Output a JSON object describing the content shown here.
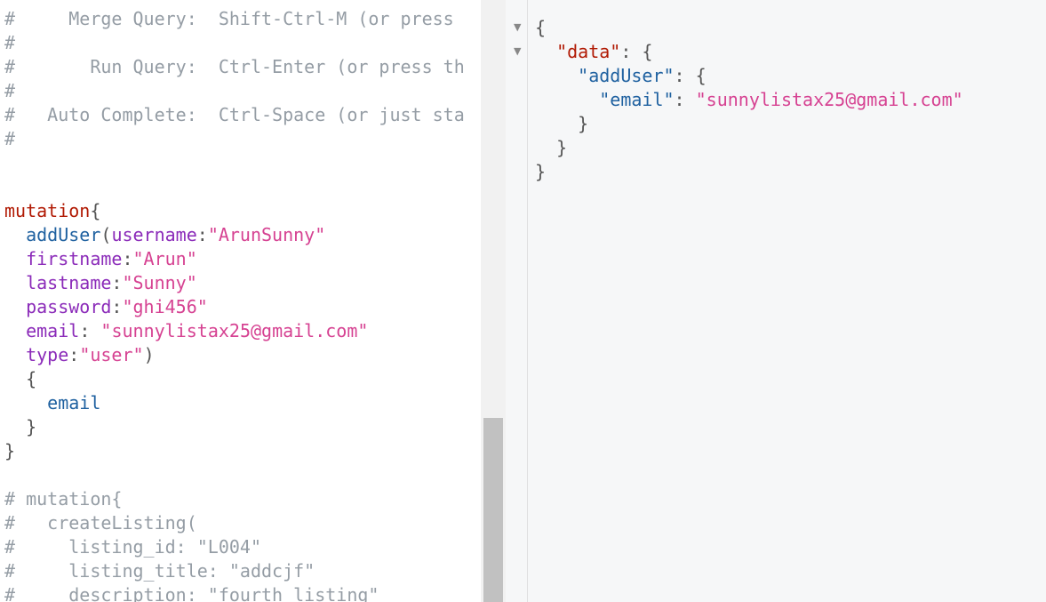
{
  "editor": {
    "lines": [
      [
        [
          "comment",
          "#     Merge Query:  Shift-Ctrl-M (or press"
        ]
      ],
      [
        [
          "comment",
          "#"
        ]
      ],
      [
        [
          "comment",
          "#       Run Query:  Ctrl-Enter (or press th"
        ]
      ],
      [
        [
          "comment",
          "#"
        ]
      ],
      [
        [
          "comment",
          "#   Auto Complete:  Ctrl-Space (or just sta"
        ]
      ],
      [
        [
          "comment",
          "#"
        ]
      ],
      [],
      [],
      [
        [
          "keyword",
          "mutation"
        ],
        [
          "punct",
          "{"
        ]
      ],
      [
        [
          "punct",
          "  "
        ],
        [
          "field",
          "addUser"
        ],
        [
          "punct",
          "("
        ],
        [
          "arg",
          "username"
        ],
        [
          "punct",
          ":"
        ],
        [
          "string",
          "\"ArunSunny\""
        ]
      ],
      [
        [
          "punct",
          "  "
        ],
        [
          "arg",
          "firstname"
        ],
        [
          "punct",
          ":"
        ],
        [
          "string",
          "\"Arun\""
        ]
      ],
      [
        [
          "punct",
          "  "
        ],
        [
          "arg",
          "lastname"
        ],
        [
          "punct",
          ":"
        ],
        [
          "string",
          "\"Sunny\""
        ]
      ],
      [
        [
          "punct",
          "  "
        ],
        [
          "arg",
          "password"
        ],
        [
          "punct",
          ":"
        ],
        [
          "string",
          "\"ghi456\""
        ]
      ],
      [
        [
          "punct",
          "  "
        ],
        [
          "arg",
          "email"
        ],
        [
          "punct",
          ": "
        ],
        [
          "string",
          "\"sunnylistax25@gmail.com\""
        ]
      ],
      [
        [
          "punct",
          "  "
        ],
        [
          "arg",
          "type"
        ],
        [
          "punct",
          ":"
        ],
        [
          "string",
          "\"user\""
        ],
        [
          "punct",
          ")"
        ]
      ],
      [
        [
          "punct",
          "  {"
        ]
      ],
      [
        [
          "punct",
          "    "
        ],
        [
          "field",
          "email"
        ]
      ],
      [
        [
          "punct",
          "  }"
        ]
      ],
      [
        [
          "punct",
          "}"
        ]
      ],
      [],
      [
        [
          "comment",
          "# mutation{"
        ]
      ],
      [
        [
          "comment",
          "#   createListing("
        ]
      ],
      [
        [
          "comment",
          "#     listing_id: \"L004\""
        ]
      ],
      [
        [
          "comment",
          "#     listing_title: \"addcjf\""
        ]
      ],
      [
        [
          "comment",
          "#     description: \"fourth listing\""
        ]
      ]
    ]
  },
  "gutter": {
    "fold_arrows": [
      "▼",
      "▼"
    ]
  },
  "results": {
    "lines": [
      [
        [
          "punct",
          "{"
        ]
      ],
      [
        [
          "punct",
          "  "
        ],
        [
          "rkey",
          "\"data\""
        ],
        [
          "punct",
          ": {"
        ]
      ],
      [
        [
          "punct",
          "    "
        ],
        [
          "rfield",
          "\"addUser\""
        ],
        [
          "punct",
          ": {"
        ]
      ],
      [
        [
          "punct",
          "      "
        ],
        [
          "rfield",
          "\"email\""
        ],
        [
          "punct",
          ": "
        ],
        [
          "rstring",
          "\"sunnylistax25@gmail.com\""
        ]
      ],
      [
        [
          "punct",
          "    }"
        ]
      ],
      [
        [
          "punct",
          "  }"
        ]
      ],
      [
        [
          "punct",
          "}"
        ]
      ]
    ]
  }
}
